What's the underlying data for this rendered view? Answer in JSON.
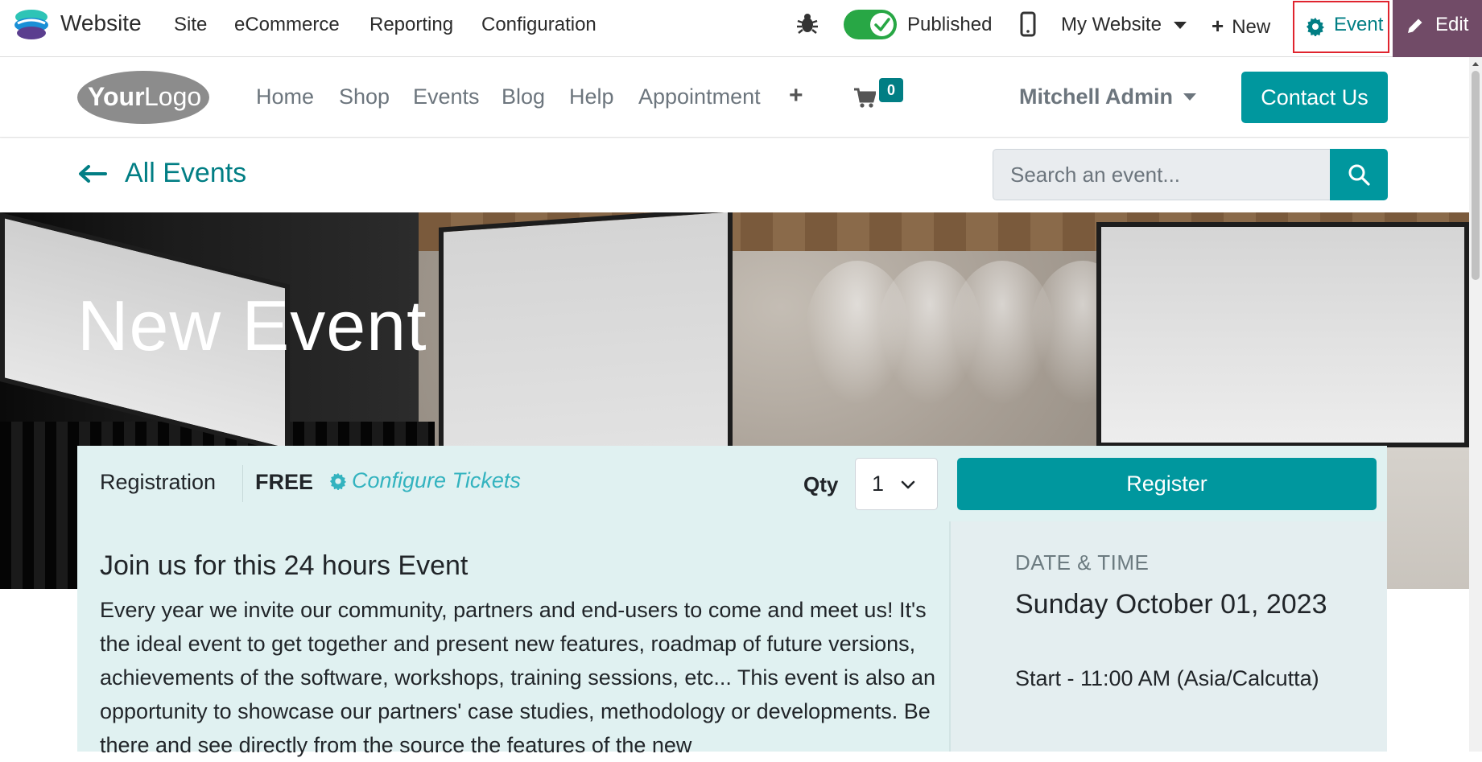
{
  "admin_bar": {
    "brand": "Website",
    "menus": [
      "Site",
      "eCommerce",
      "Reporting",
      "Configuration"
    ],
    "published_label": "Published",
    "published": true,
    "website_selector": "My Website",
    "new_label": "New",
    "event_label": "Event",
    "edit_label": "Edit",
    "colors": {
      "toggle": "#28a745",
      "edit_bg": "#714b67",
      "highlight_box": "#e0242e",
      "event_text": "#017e84"
    }
  },
  "site_header": {
    "logo_icon": "your-logo",
    "nav": [
      "Home",
      "Shop",
      "Events",
      "Blog",
      "Help",
      "Appointment"
    ],
    "cart_count": "0",
    "user": "Mitchell Admin",
    "contact_label": "Contact Us",
    "colors": {
      "primary": "#00979e"
    }
  },
  "sub_bar": {
    "back_label": "All Events",
    "search_placeholder": "Search an event..."
  },
  "hero": {
    "title": "New Event"
  },
  "registration": {
    "label": "Registration",
    "price": "FREE",
    "configure_label": "Configure Tickets",
    "qty_label": "Qty",
    "qty_value": "1",
    "register_label": "Register"
  },
  "content": {
    "heading": "Join us for this 24 hours Event",
    "description": "Every year we invite our community, partners and end-users to come and meet us! It's the ideal event to get together and present new features, roadmap of future versions, achievements of the software, workshops, training sessions, etc... This event is also an opportunity to showcase our partners' case studies, methodology or developments. Be there and see directly from the source the features of the new"
  },
  "date_time": {
    "label": "DATE & TIME",
    "date": "Sunday October 01, 2023",
    "start": "Start - 11:00 AM (Asia/Calcutta)"
  }
}
